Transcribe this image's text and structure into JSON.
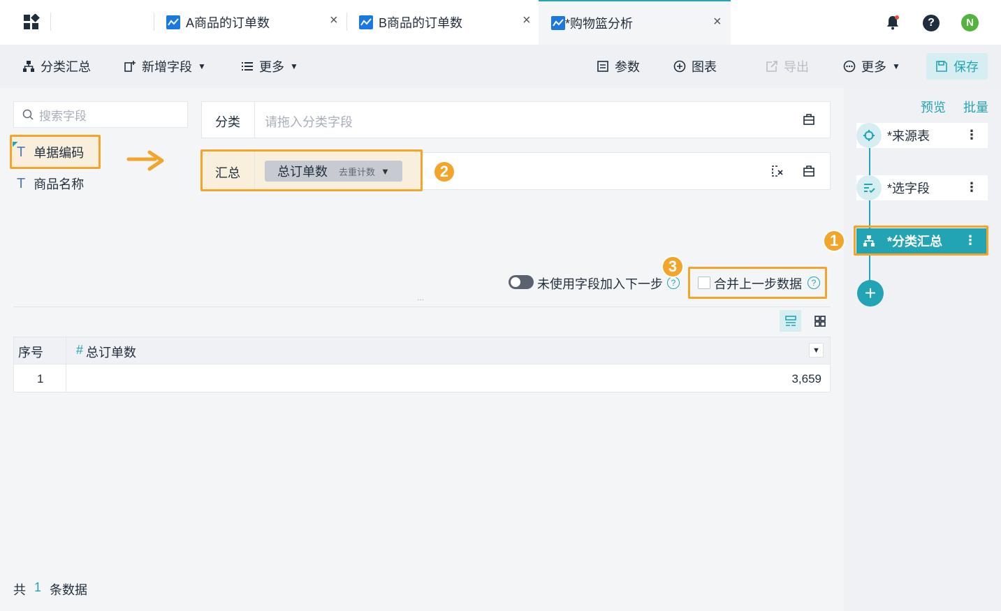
{
  "tabs": [
    {
      "label": "A商品的订单数"
    },
    {
      "label": "B商品的订单数"
    },
    {
      "label": "*购物篮分析"
    }
  ],
  "header": {
    "avatar_letter": "N"
  },
  "toolbar": {
    "group_summary": "分类汇总",
    "add_field": "新增字段",
    "more_left": "更多",
    "params": "参数",
    "chart": "图表",
    "export": "导出",
    "more_right": "更多",
    "save": "保存"
  },
  "left": {
    "search_placeholder": "搜索字段",
    "fields": [
      "单据编码",
      "商品名称"
    ]
  },
  "config": {
    "category_label": "分类",
    "category_placeholder": "请拖入分类字段",
    "summary_label": "汇总",
    "summary_chip": "总订单数",
    "summary_chip_mode": "去重计数",
    "unused_toggle_label": "未使用字段加入下一步",
    "merge_label": "合并上一步数据",
    "drag_handle": "..."
  },
  "badges": {
    "one": "1",
    "two": "2",
    "three": "3"
  },
  "table": {
    "headers": [
      "序号",
      "总订单数"
    ],
    "rows": [
      {
        "index": "1",
        "value": "3,659"
      }
    ]
  },
  "footer": {
    "prefix": "共",
    "count": "1",
    "suffix": "条数据"
  },
  "right": {
    "preview": "预览",
    "batch": "批量",
    "steps": [
      "*来源表",
      "*选字段",
      "*分类汇总"
    ]
  },
  "colors": {
    "accent": "#23a4b4",
    "highlight": "#f2a42b"
  }
}
